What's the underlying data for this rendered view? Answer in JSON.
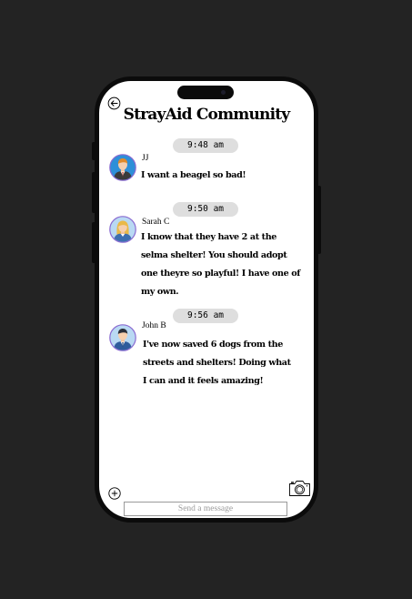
{
  "app": {
    "title": "StrayAid Community"
  },
  "messages": [
    {
      "time": "9:48 am",
      "sender": "JJ",
      "text": "I want a beagel so bad!",
      "avatar": "man-avatar-orange-hair"
    },
    {
      "time": "9:50 am",
      "sender": "Sarah C",
      "text": "I know that they have 2 at the selma shelter! You should adopt one theyre so playful! I have one of my own.",
      "avatar": "woman-avatar-blonde"
    },
    {
      "time": "9:56 am",
      "sender": "John B",
      "text": "I've now saved 6 dogs from the streets and shelters! Doing what I can and it feels amazing!",
      "avatar": "man-avatar-dark-hair"
    }
  ],
  "composer": {
    "placeholder": "Send a message"
  },
  "icons": {
    "back": "back-arrow-icon",
    "add": "plus-icon",
    "camera": "camera-icon"
  },
  "colors": {
    "time_pill": "#dedede",
    "background": "#232323",
    "avatar_ring": "#8a6bd1"
  }
}
